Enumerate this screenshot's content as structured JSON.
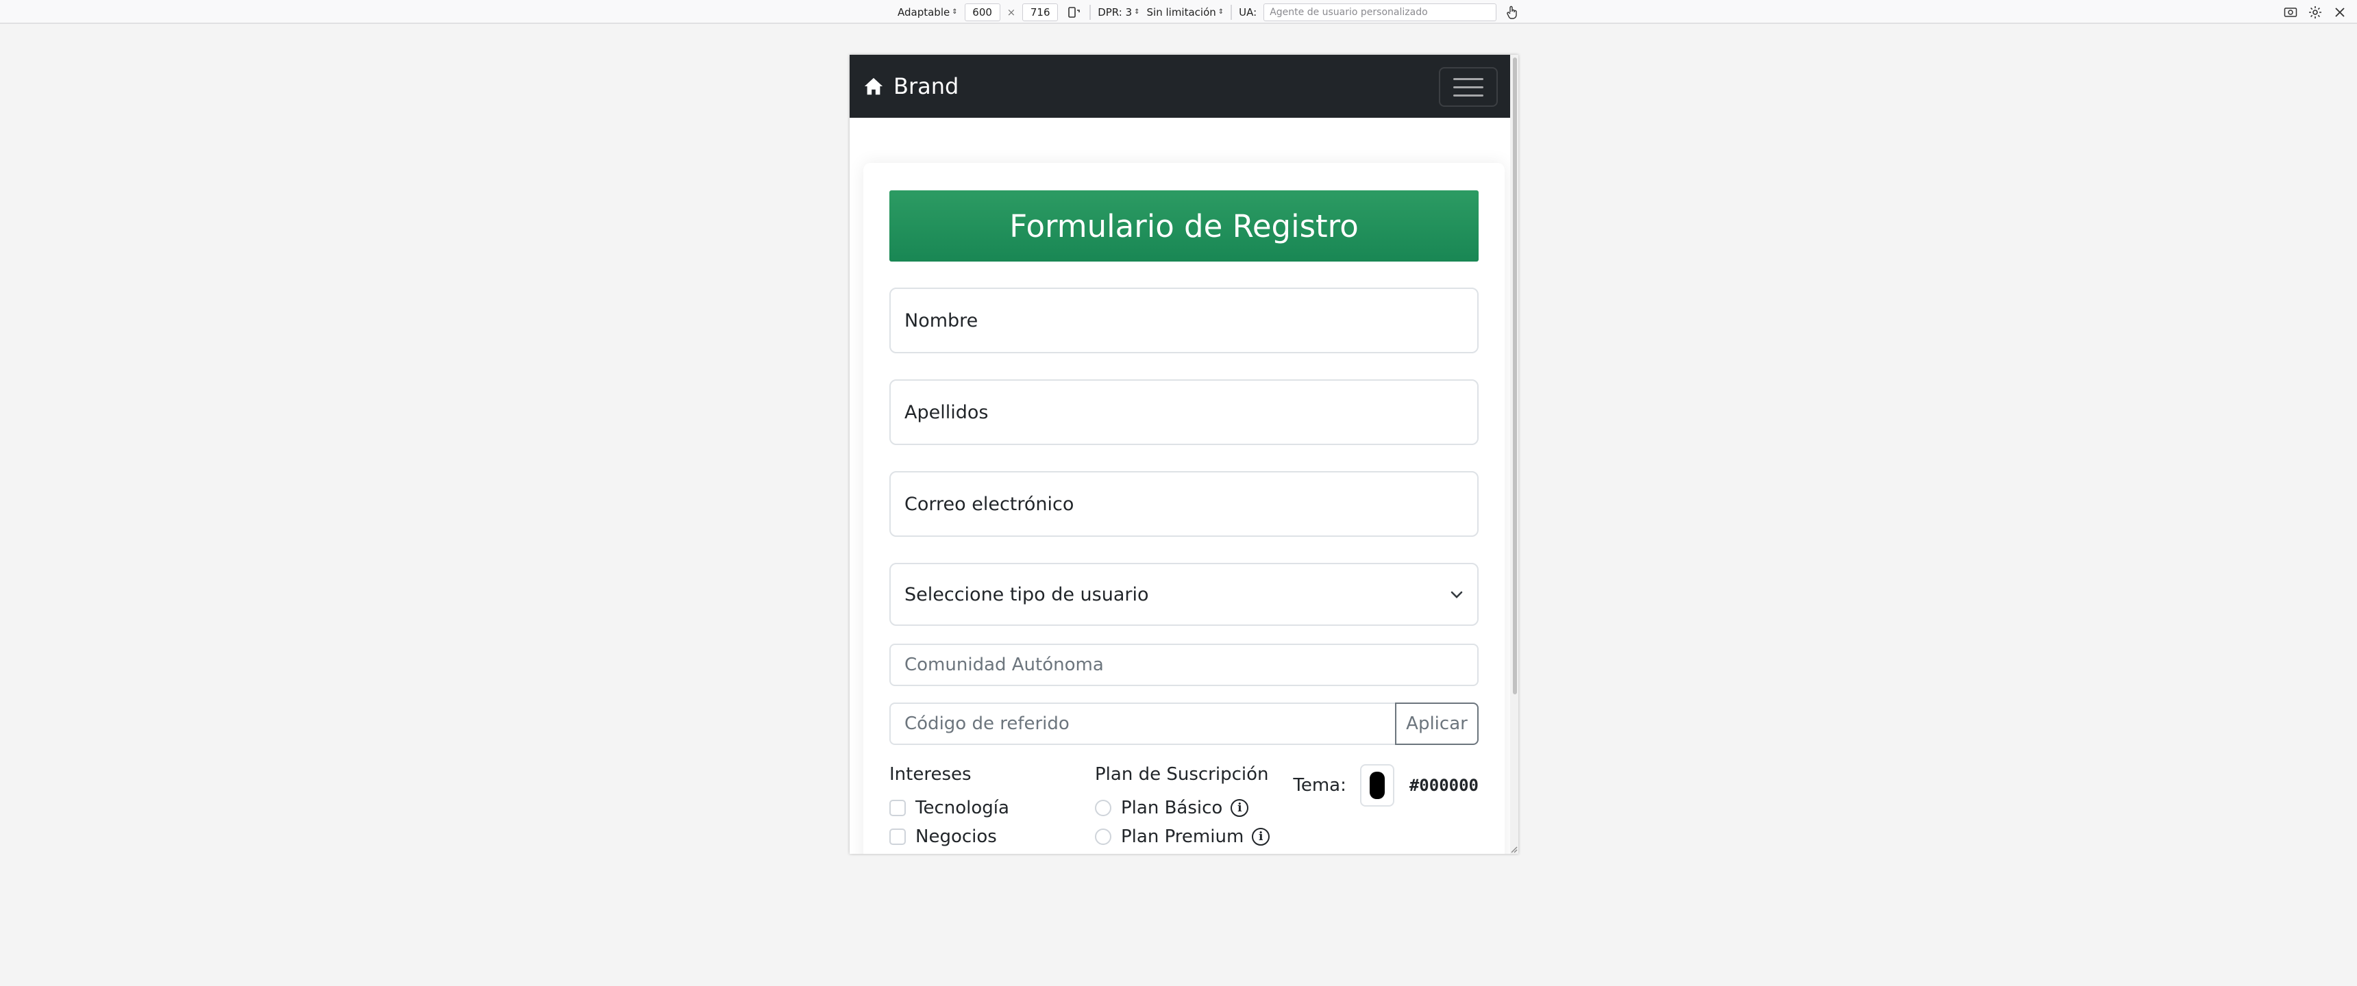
{
  "toolbar": {
    "device_label": "Adaptable",
    "width": "600",
    "times": "×",
    "height": "716",
    "dpr_label": "DPR: 3",
    "throttling_label": "Sin limitación",
    "ua_label": "UA:",
    "ua_placeholder": "Agente de usuario personalizado",
    "icons": [
      "rotate-icon",
      "touch-icon",
      "screenshot-icon",
      "settings-icon",
      "close-icon"
    ]
  },
  "page": {
    "brand": "Brand",
    "brand_icon": "home-icon",
    "menu_icon": "hamburger-icon",
    "form": {
      "title": "Formulario de Registro",
      "title_color": "#198754",
      "nombre": "Nombre",
      "apellidos": "Apellidos",
      "correo": "Correo electrónico",
      "tipo_usuario": "Seleccione tipo de usuario",
      "comunidad": "Comunidad Autónoma",
      "referido": "Código de referido",
      "aplicar": "Aplicar",
      "intereses_title": "Intereses",
      "intereses": [
        "Tecnología",
        "Negocios"
      ],
      "plan_title": "Plan de Suscripción",
      "planes": [
        "Plan Básico",
        "Plan Premium"
      ],
      "tema_label": "Tema:",
      "tema_value": "#000000"
    }
  }
}
